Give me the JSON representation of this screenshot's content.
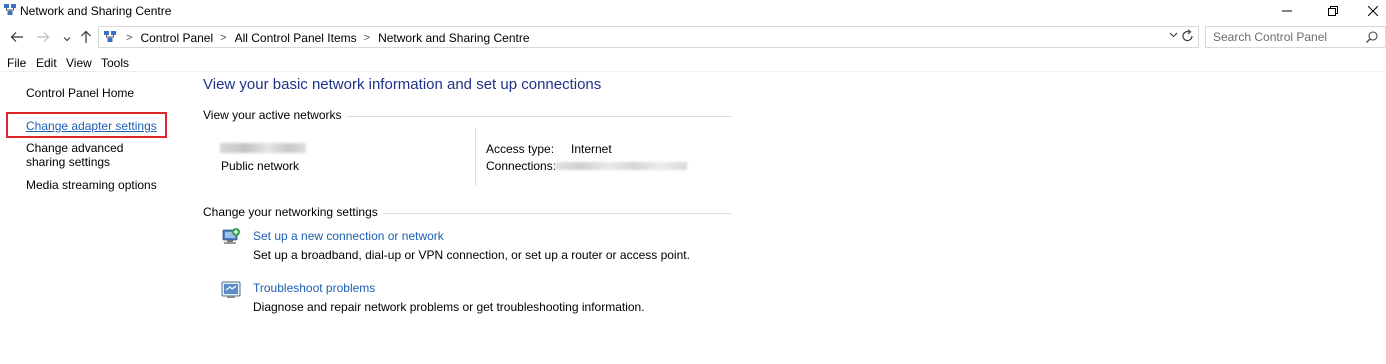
{
  "window": {
    "title": "Network and Sharing Centre",
    "icon": "network-sharing-icon"
  },
  "address": {
    "crumbs": [
      "Control Panel",
      "All Control Panel Items",
      "Network and Sharing Centre"
    ],
    "search_placeholder": "Search Control Panel"
  },
  "menu": {
    "items": [
      "File",
      "Edit",
      "View",
      "Tools"
    ]
  },
  "sidebar": {
    "home": "Control Panel Home",
    "adapter": "Change adapter settings",
    "sharing": "Change advanced sharing settings",
    "media": "Media streaming options"
  },
  "main": {
    "title": "View your basic network information and set up connections",
    "active_networks_label": "View your active networks",
    "network_type": "Public network",
    "access_type_label": "Access type:",
    "access_type_value": "Internet",
    "connections_label": "Connections:",
    "change_settings_label": "Change your networking settings",
    "tasks": [
      {
        "link": "Set up a new connection or network",
        "desc": "Set up a broadband, dial-up or VPN connection, or set up a router or access point.",
        "icon": "new-connection-icon"
      },
      {
        "link": "Troubleshoot problems",
        "desc": "Diagnose and repair network problems or get troubleshooting information.",
        "icon": "troubleshoot-icon"
      }
    ]
  },
  "colors": {
    "link": "#1a5fb4",
    "title": "#1e3287",
    "highlight": "#e0262b"
  }
}
